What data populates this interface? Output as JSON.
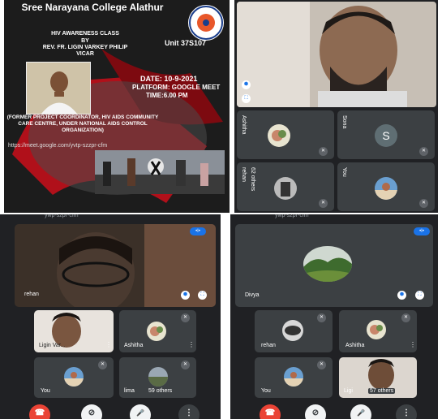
{
  "poster": {
    "college": "Sree Narayana College Alathur",
    "unit": "Unit 37S107",
    "class_title": "HIV AWARENESS CLASS",
    "by": "BY",
    "speaker": "REV. FR. LIGIN VARKEY PHILIP",
    "speaker_role": "VICAR",
    "date": "DATE: 10-9-2021",
    "platform": "PLATFORM: GOOGLE MEET",
    "time": "TIME:6.00 PM",
    "credentials": "(FORMER PROJECT COORDINATOR, HIV AIDS COMMUNITY CARE CENTRE, UNDER NATIONAL AIDS CONTROL ORGANIZATION)",
    "link": "https://meet.google.com/yvtp-szzpr-cfm"
  },
  "meet1": {
    "tiles": [
      {
        "name": "Ashitha"
      },
      {
        "name": "Sona",
        "initial": "S"
      },
      {
        "name": "rehan",
        "others": "62 others"
      },
      {
        "name": "You"
      }
    ]
  },
  "meet2": {
    "top_bar": "ywp-szpr-cfm",
    "main": {
      "name": "rehan"
    },
    "tiles": [
      {
        "name": "Ligin Var..."
      },
      {
        "name": "Ashitha"
      },
      {
        "name": "You"
      },
      {
        "name": "lima",
        "others": "59 others"
      }
    ]
  },
  "meet3": {
    "top_bar": "ywp-szpr-cfm",
    "main": {
      "name": "Divya"
    },
    "tiles": [
      {
        "name": "rehan"
      },
      {
        "name": "Ashitha"
      },
      {
        "name": "You"
      },
      {
        "name": "Ligi",
        "others": "57 others"
      }
    ]
  },
  "controls": {
    "end": "☎",
    "cam": "⊘",
    "mic": "🎤",
    "more": "⋮"
  },
  "colors": {
    "meet_bg": "#202124",
    "tile_bg": "#3c4043",
    "end_call": "#ea4335"
  }
}
